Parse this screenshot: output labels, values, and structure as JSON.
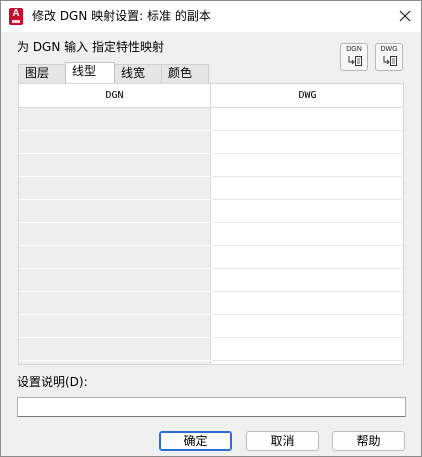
{
  "window": {
    "title": "修改 DGN 映射设置: 标准 的副本",
    "app_icon": "autocad-a-icon",
    "accent": "#c8102e"
  },
  "heading": "为 DGN 输入 指定特性映射",
  "buttons_top": {
    "dgn_label": "DGN",
    "dwg_label": "DWG"
  },
  "tabs": [
    {
      "label": "图层"
    },
    {
      "label": "线型"
    },
    {
      "label": "线宽"
    },
    {
      "label": "颜色"
    }
  ],
  "active_tab_index": 1,
  "table": {
    "columns": [
      "DGN",
      "DWG"
    ],
    "rows": [
      [
        "",
        ""
      ],
      [
        "",
        ""
      ],
      [
        "",
        ""
      ],
      [
        "",
        ""
      ],
      [
        "",
        ""
      ],
      [
        "",
        ""
      ],
      [
        "",
        ""
      ],
      [
        "",
        ""
      ],
      [
        "",
        ""
      ],
      [
        "",
        ""
      ],
      [
        "",
        ""
      ],
      [
        "",
        ""
      ]
    ]
  },
  "description": {
    "label": "设置说明(D):",
    "value": ""
  },
  "footer": {
    "ok_label": "确定",
    "cancel_label": "取消",
    "help_label": "帮助"
  }
}
